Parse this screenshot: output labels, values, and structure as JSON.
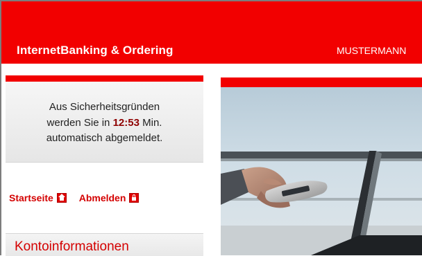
{
  "header": {
    "title": "InternetBanking & Ordering",
    "user": "MUSTERMANN"
  },
  "session": {
    "line1": "Aus Sicherheitsgründen",
    "line2_prefix": "werden Sie in ",
    "time": "12:53",
    "line2_suffix": " Min.",
    "line3": "automatisch abgemeldet."
  },
  "links": {
    "home": "Startseite",
    "logout": "Abmelden"
  },
  "sidebar": {
    "section_title": "Kontoinformationen"
  },
  "colors": {
    "brand_red": "#f20000",
    "link_red": "#d40000",
    "time_red": "#8e0000"
  },
  "icons": [
    "home-icon",
    "lock-icon"
  ]
}
